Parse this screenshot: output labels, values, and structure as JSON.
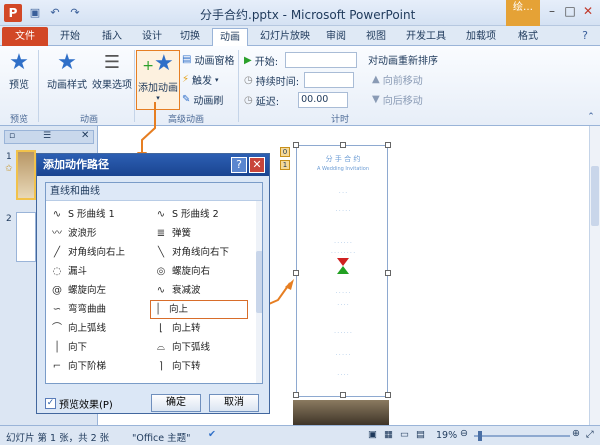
{
  "titlebar": {
    "logo": "P",
    "title": "分手合约.pptx  -  Microsoft PowerPoint",
    "context_tab": "绘…",
    "save_icon": "save-icon",
    "undo_icon": "undo-icon",
    "redo_icon": "redo-icon"
  },
  "tabs": {
    "file": "文件",
    "items": [
      "开始",
      "插入",
      "设计",
      "切换",
      "动画",
      "幻灯片放映",
      "审阅",
      "视图",
      "开发工具",
      "加载项",
      "格式"
    ]
  },
  "ribbon": {
    "preview": "预览",
    "preview_group": "预览",
    "anim_style": "动画样式",
    "effect_options": "效果选项",
    "anim_group": "动画",
    "add_anim": "添加动画",
    "anim_pane": "动画窗格",
    "trigger": "触发",
    "anim_brush": "动画刷",
    "adv_group": "高级动画",
    "start_label": "开始:",
    "duration_label": "持续时间:",
    "delay_label": "延迟:",
    "delay_value": "00.00",
    "timing_group": "计时",
    "reorder": "对动画重新排序",
    "move_earlier": "向前移动",
    "move_later": "向后移动"
  },
  "slides": [
    {
      "number": "1",
      "star": "✩"
    },
    {
      "number": "2"
    }
  ],
  "slide_content": {
    "title": "分 手 合 约",
    "subtitle": "A Wedding Invitation",
    "tag1": "1",
    "tag0": "0"
  },
  "dialog": {
    "title": "添加动作路径",
    "help": "?",
    "close": "✕",
    "category": "直线和曲线",
    "paths_left": [
      "S 形曲线 1",
      "波浪形",
      "对角线向右上",
      "漏斗",
      "螺旋向左",
      "弯弯曲曲",
      "向上弧线",
      "向下",
      "向下阶梯"
    ],
    "paths_right": [
      "S 形曲线 2",
      "弹簧",
      "对角线向右下",
      "螺旋向右",
      "衰减波",
      "向上",
      "向上转",
      "向下弧线",
      "向下转"
    ],
    "preview_label": "预览效果(P)",
    "ok": "确定",
    "cancel": "取消"
  },
  "statusbar": {
    "slide_info": "幻灯片 第 1 张，共 2 张",
    "theme": "\"Office 主题\"",
    "zoom": "19%"
  }
}
